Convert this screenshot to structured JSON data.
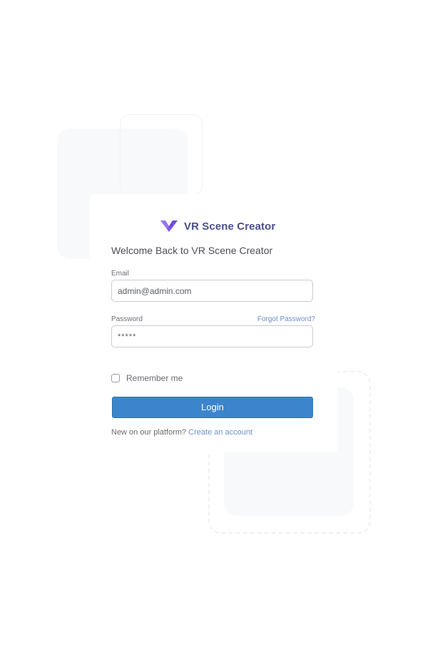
{
  "brand": {
    "logo_icon": "brand-v-logo-icon",
    "name": "VR Scene Creator"
  },
  "login": {
    "welcome": "Welcome Back to VR Scene Creator",
    "email_label": "Email",
    "email_value": "admin@admin.com",
    "password_label": "Password",
    "forgot_password": "Forgot Password?",
    "password_value": "*****",
    "remember_me": "Remember me",
    "remember_checked": false,
    "login_button": "Login",
    "signup_prompt": "New on our platform?",
    "signup_link": "Create an account"
  },
  "colors": {
    "brand_purple": "#7d5be6",
    "brand_text": "#4a4f8a",
    "primary_button": "#3c85cc",
    "link": "#6d90c8",
    "decor": "#f8f9fb"
  }
}
